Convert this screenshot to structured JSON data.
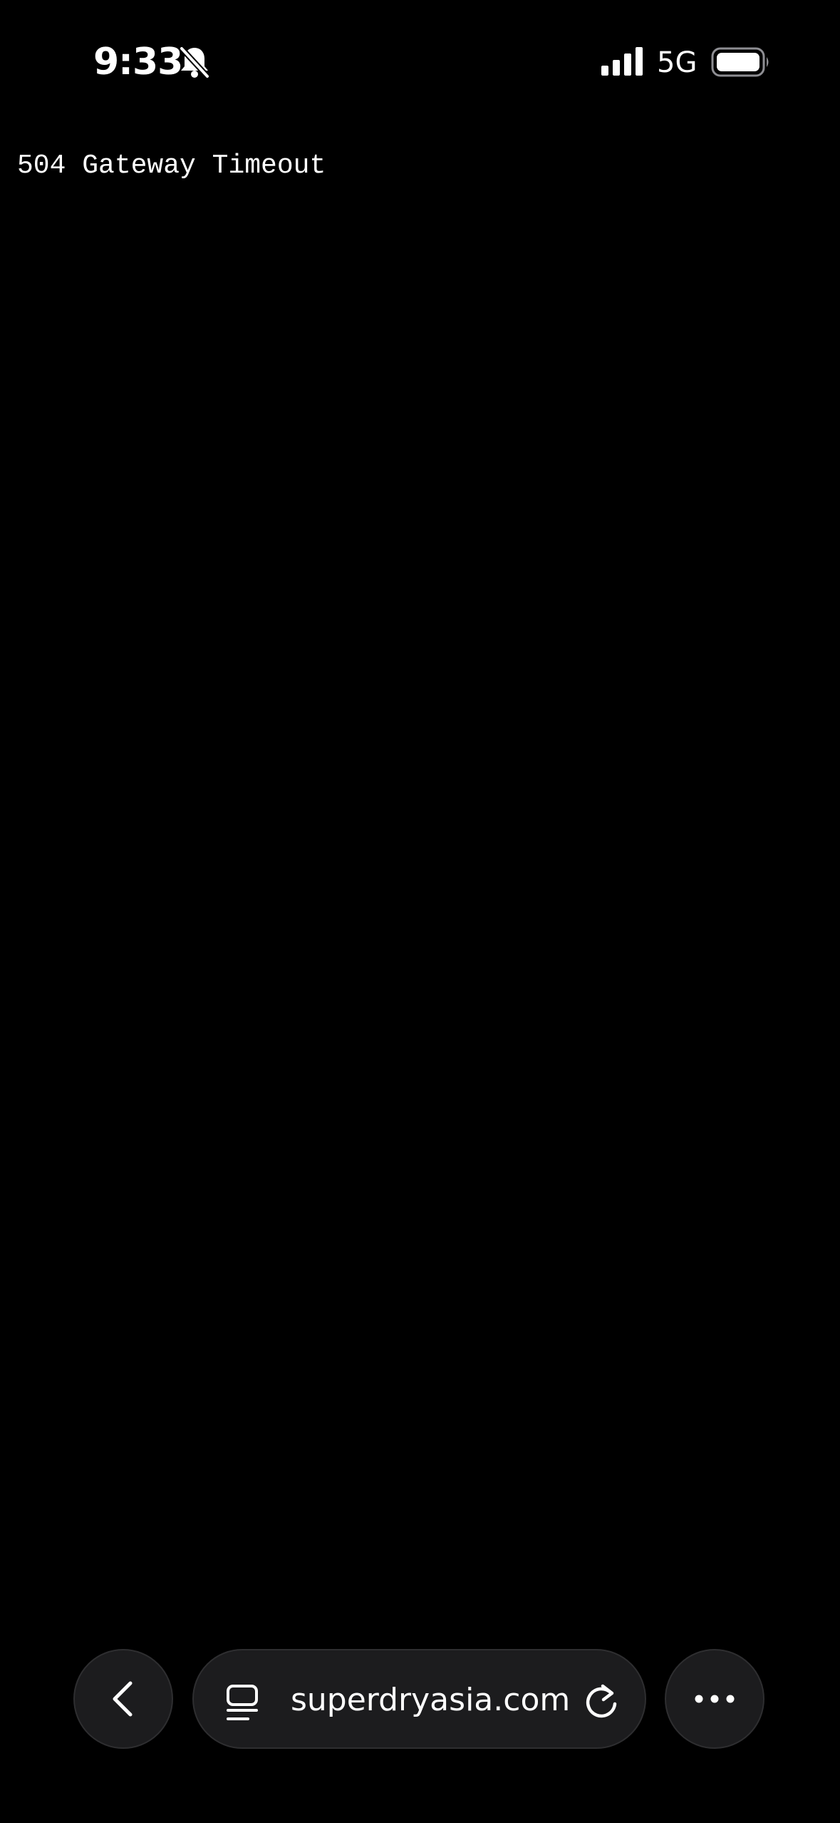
{
  "status_bar": {
    "time": "9:33",
    "network": "5G",
    "icons": {
      "silent": "bell-slash-icon",
      "signal": "signal-icon",
      "battery": "battery-icon"
    }
  },
  "page": {
    "error_message": "504 Gateway Timeout"
  },
  "browser_toolbar": {
    "url": "superdryasia.com",
    "icons": {
      "back": "chevron-left-icon",
      "tabs": "tab-overview-icon",
      "reload": "reload-icon",
      "more": "more-icon"
    }
  },
  "colors": {
    "background": "#000000",
    "text": "#ffffff",
    "toolbar_button": "#1c1c1e"
  }
}
